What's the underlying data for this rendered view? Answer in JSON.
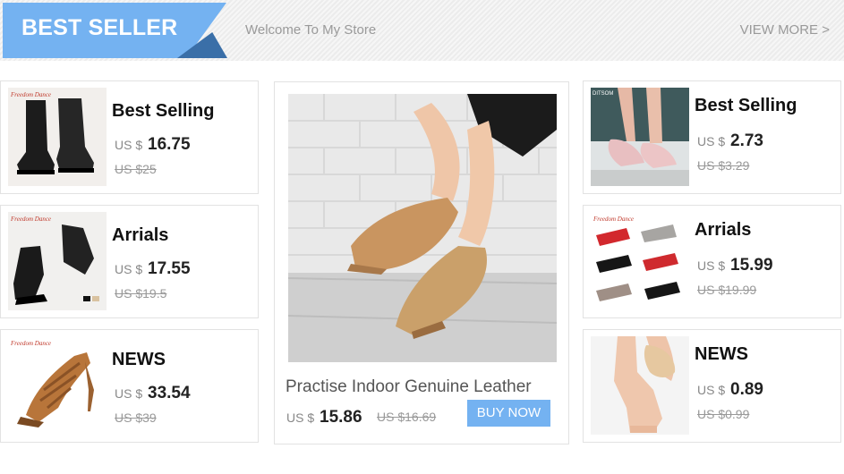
{
  "header": {
    "badge_title": "BEST SELLER",
    "welcome_text": "Welcome To My Store",
    "view_more_label": "VIEW MORE >",
    "badge_color": "#74b2f1"
  },
  "left_cards": [
    {
      "title": "Best Selling",
      "currency": "US $",
      "price": "16.75",
      "old_price": "US $25",
      "image": "black-canvas-boots-image",
      "brand_mark": "Freedom Dance"
    },
    {
      "title": "Arrials",
      "currency": "US $",
      "price": "17.55",
      "old_price": "US $19.5",
      "image": "black-jazz-shoes-image",
      "brand_mark": "Freedom Dance"
    },
    {
      "title": "NEWS",
      "currency": "US $",
      "price": "33.54",
      "old_price": "US $39",
      "image": "tan-latin-heel-image",
      "brand_mark": "Freedom Dance"
    }
  ],
  "right_cards": [
    {
      "title": "Best Selling",
      "currency": "US $",
      "price": "2.73",
      "old_price": "US $3.29",
      "image": "pink-ballet-slippers-image",
      "brand_mark": "DITSOM"
    },
    {
      "title": "Arrials",
      "currency": "US $",
      "price": "15.99",
      "old_price": "US $19.99",
      "image": "ballroom-shoes-grid-image",
      "brand_mark": "Freedom Dance"
    },
    {
      "title": "NEWS",
      "currency": "US $",
      "price": "0.89",
      "old_price": "US $0.99",
      "image": "foot-paw-image"
    }
  ],
  "featured": {
    "title": "Practise Indoor Genuine Leather",
    "currency": "US $",
    "price": "15.86",
    "old_price": "US $16.69",
    "button_label": "BUY NOW",
    "image": "tan-leather-jazz-shoes-image",
    "button_color": "#74b2f1"
  }
}
